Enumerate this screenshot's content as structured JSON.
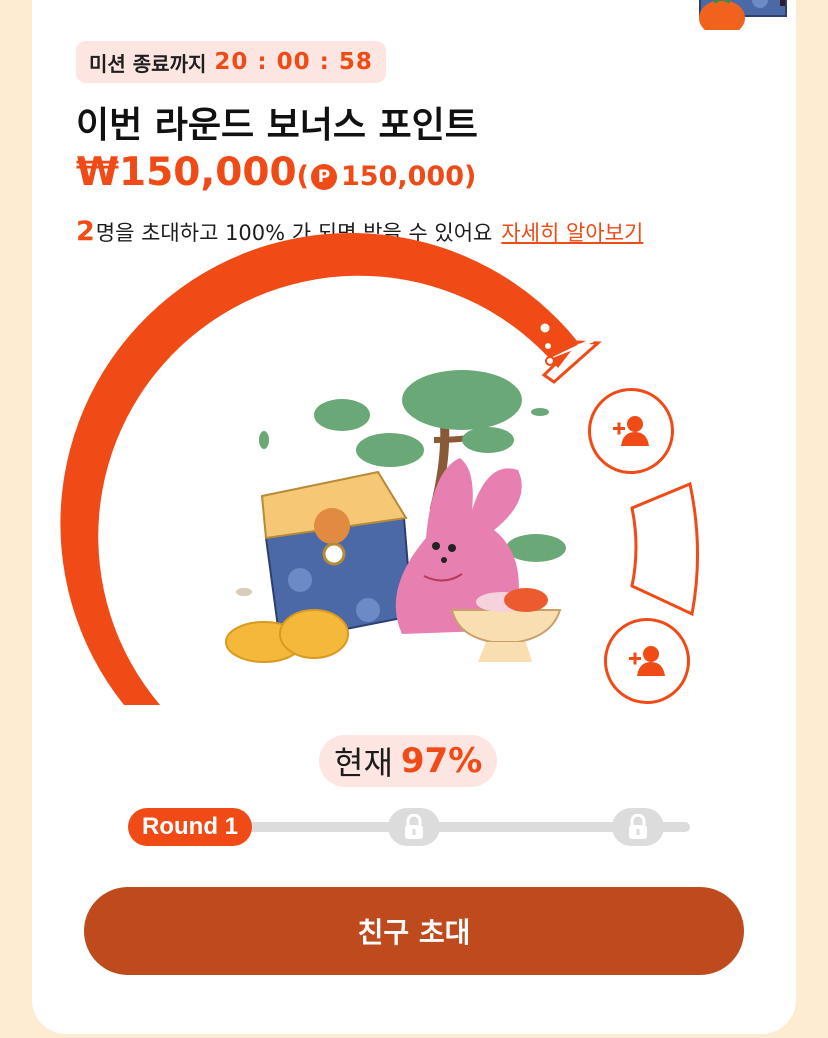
{
  "mission": {
    "timer_label": "미션 종료까지",
    "timer_value": "20 : 00 : 58"
  },
  "bonus": {
    "title": "이번 라운드 보너스 포인트",
    "amount": "₩150,000",
    "points_open": "(",
    "points_symbol": "P",
    "points_value": "150,000)"
  },
  "condition": {
    "invite_count": "2",
    "text": "명을 초대하고 100% 가 되면 받을 수 있어요",
    "link_label": "자세히 알아보기"
  },
  "progress": {
    "current_label": "현재",
    "current_value": "97%",
    "percent": 97
  },
  "rounds": {
    "active_label": "Round 1",
    "items": [
      {
        "name": "Round 1",
        "locked": false
      },
      {
        "name": "round-2",
        "locked": true
      },
      {
        "name": "round-3",
        "locked": true
      }
    ]
  },
  "cta": {
    "label": "친구 초대"
  },
  "colors": {
    "accent": "#f04a16",
    "cta": "#bf4a1e",
    "background": "#fdecd2",
    "badge_bg": "#fde6e1",
    "track": "#dcdcdc"
  },
  "icons": [
    "add-friend-icon",
    "lock-icon",
    "point-coin-icon"
  ]
}
